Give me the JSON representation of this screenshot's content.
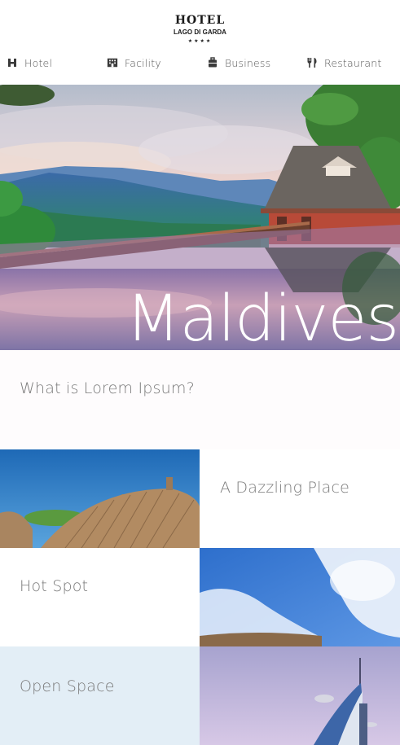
{
  "logo": {
    "line1": "HOTEL",
    "line2": "LAGO DI GARDA",
    "stars": "★★★★"
  },
  "nav": {
    "items": [
      {
        "label": "Hotel",
        "icon": "hotel-h-icon"
      },
      {
        "label": "Facility",
        "icon": "building-icon"
      },
      {
        "label": "Business",
        "icon": "briefcase-icon"
      },
      {
        "label": "Restaurant",
        "icon": "fork-knife-icon"
      }
    ]
  },
  "hero": {
    "title": "Maldives"
  },
  "intro": {
    "text": "What is Lorem Ipsum?"
  },
  "tiles": {
    "dazzling": "A Dazzling Place",
    "hotspot": "Hot Spot",
    "openspace": "Open Space"
  },
  "colors": {
    "text": "#7a7a7a",
    "open_space_bg": "#e3eef6",
    "hotspot_bg": "#ffffff"
  }
}
